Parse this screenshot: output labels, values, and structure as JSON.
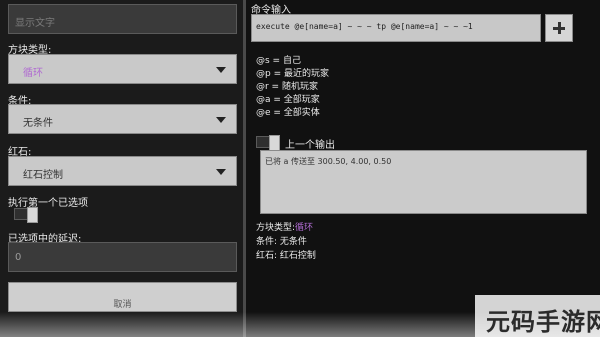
{
  "left_panel": {
    "name_field": {
      "placeholder": "显示文字"
    },
    "block_type": {
      "label": "方块类型:",
      "value": "循环"
    },
    "condition": {
      "label": "条件:",
      "value": "无条件"
    },
    "redstone": {
      "label": "红石:",
      "value": "红石控制"
    },
    "execute_first": {
      "label": "执行第一个已选项"
    },
    "delay": {
      "label": "已选项中的延迟:",
      "value": "0"
    },
    "cancel_label": "取消"
  },
  "right_panel": {
    "command_input": {
      "label": "命令输入",
      "value": "execute @e[name=a] ~ ~ ~ tp @e[name=a] ~ ~ ~1"
    },
    "add_icon": "plus-icon",
    "selectors": [
      "@s = 自己",
      "@p = 最近的玩家",
      "@r = 随机玩家",
      "@a = 全部玩家",
      "@e = 全部实体"
    ],
    "previous_output": {
      "label": "上一个输出",
      "text": "已将 a 传送至 300.50, 4.00, 0.50"
    },
    "info": {
      "block_type_label": "方块类型:",
      "block_type_value": "循环",
      "condition": "条件: 无条件",
      "redstone": "红石: 红石控制"
    }
  },
  "watermark": "元码手游网",
  "colors": {
    "accent_purple": "#b06bd1",
    "panel_dark": "#1b1b1b",
    "field_light": "#c9c9c9"
  }
}
